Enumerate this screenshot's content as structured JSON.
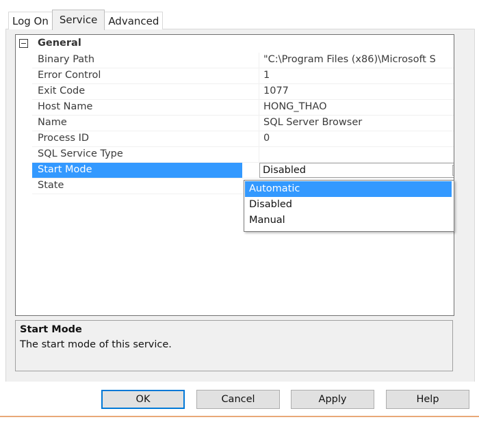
{
  "tabs": [
    {
      "label": "Log On",
      "active": false
    },
    {
      "label": "Service",
      "active": true
    },
    {
      "label": "Advanced",
      "active": false
    }
  ],
  "grid": {
    "category": "General",
    "properties": [
      {
        "name": "Binary Path",
        "value": "\"C:\\Program Files (x86)\\Microsoft S"
      },
      {
        "name": "Error Control",
        "value": "1"
      },
      {
        "name": "Exit Code",
        "value": "1077"
      },
      {
        "name": "Host Name",
        "value": "HONG_THAO"
      },
      {
        "name": "Name",
        "value": "SQL Server Browser"
      },
      {
        "name": "Process ID",
        "value": "0"
      },
      {
        "name": "SQL Service Type",
        "value": ""
      },
      {
        "name": "Start Mode",
        "value": "Disabled",
        "selected": true
      },
      {
        "name": "State",
        "value": ""
      }
    ]
  },
  "dropdown": {
    "options": [
      "Automatic",
      "Disabled",
      "Manual"
    ],
    "highlighted": "Automatic"
  },
  "description": {
    "title": "Start Mode",
    "text": "The start mode of this service."
  },
  "buttons": {
    "ok": "OK",
    "cancel": "Cancel",
    "apply": "Apply",
    "help": "Help"
  },
  "colors": {
    "selection": "#3399ff",
    "default_button_border": "#0078d7"
  },
  "icons": {
    "collapse": "minus-box-icon",
    "dropdown_arrow": "chevron-down-icon"
  }
}
